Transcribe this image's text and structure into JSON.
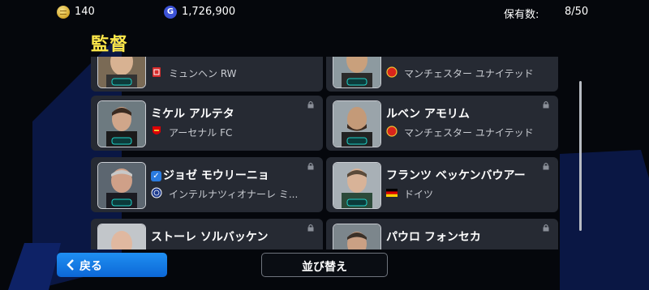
{
  "header": {
    "coins": "140",
    "gp": "1,726,900",
    "gp_icon_letter": "G",
    "possession_label": "保有数:",
    "possession_value": "8/50"
  },
  "title": "監督",
  "cards": [
    {
      "name": "",
      "team": "ミュンヘン RW",
      "badge": "munchen-badge",
      "locked": false
    },
    {
      "name": "",
      "team": "マンチェスター ユナイテッド",
      "badge": "man-utd-badge",
      "locked": false
    },
    {
      "name": "ミケル アルテタ",
      "team": "アーセナル FC",
      "badge": "arsenal-badge",
      "locked": true
    },
    {
      "name": "ルベン アモリム",
      "team": "マンチェスター ユナイテッド",
      "badge": "man-utd-badge",
      "locked": true
    },
    {
      "name": "ジョゼ モウリーニョ",
      "team": "インテルナツィオナーレ ミ...",
      "badge": "inter-badge",
      "locked": true,
      "verified": true
    },
    {
      "name": "フランツ ベッケンバウアー",
      "team": "ドイツ",
      "badge": "germany-flag",
      "locked": true
    },
    {
      "name": "ストーレ ソルバッケン",
      "team": "",
      "badge": "",
      "locked": true
    },
    {
      "name": "パウロ フォンセカ",
      "team": "",
      "badge": "",
      "locked": true
    }
  ],
  "footer": {
    "back_label": "戻る",
    "sort_label": "並び替え"
  },
  "colors": {
    "title": "#ffe84a",
    "card": "#262a33",
    "back_button": "#1f8ff2"
  }
}
